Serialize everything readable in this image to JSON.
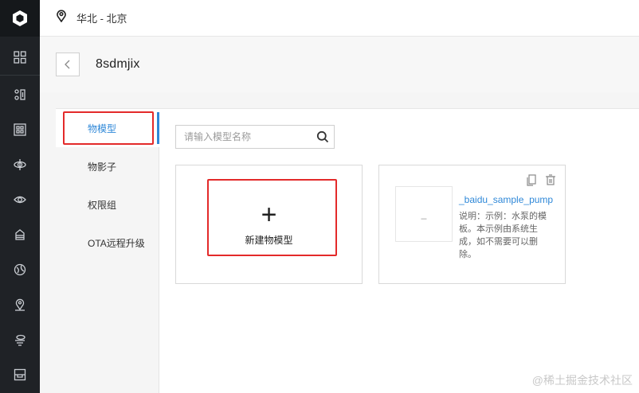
{
  "header": {
    "region": "华北 - 北京"
  },
  "page": {
    "title": "8sdmjix"
  },
  "nav_rail": {
    "items": [
      "logo-icon",
      "dashboard-icon",
      "iot-hub-icon",
      "device-icon",
      "rule-icon",
      "visual-icon",
      "data-icon",
      "monitor-icon",
      "location-icon",
      "edge-icon",
      "storage-icon"
    ]
  },
  "subnav": {
    "tabs": [
      {
        "label": "物模型",
        "active": true
      },
      {
        "label": "物影子",
        "active": false
      },
      {
        "label": "权限组",
        "active": false
      },
      {
        "label": "OTA远程升级",
        "active": false
      }
    ]
  },
  "search": {
    "placeholder": "请输入模型名称"
  },
  "new_card": {
    "plus": "+",
    "label": "新建物模型"
  },
  "model_card": {
    "thumb": "_",
    "name": "_baidu_sample_pump",
    "description": "说明：示例：水泵的模板。本示例由系统生成，如不需要可以删除。"
  },
  "watermark": "@稀土掘金技术社区",
  "colors": {
    "accent": "#2f88d8",
    "highlight": "#e32a2a",
    "rail": "#1f2226"
  }
}
